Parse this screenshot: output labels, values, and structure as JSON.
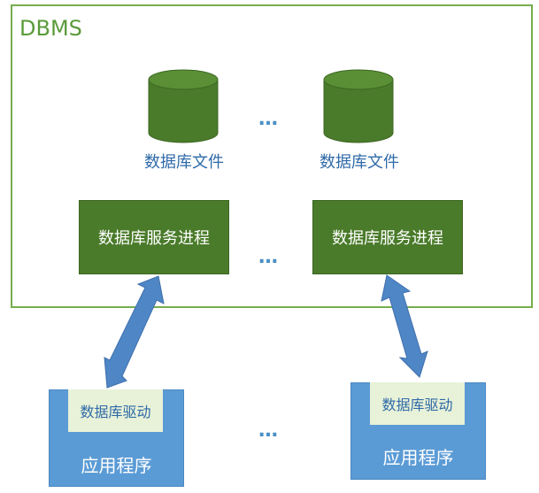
{
  "dbms": {
    "title": "DBMS",
    "files": [
      {
        "label": "数据库文件"
      },
      {
        "label": "数据库文件"
      }
    ],
    "services": [
      {
        "label": "数据库服务进程"
      },
      {
        "label": "数据库服务进程"
      }
    ]
  },
  "apps": [
    {
      "driver_label": "数据库驱动",
      "label": "应用程序"
    },
    {
      "driver_label": "数据库驱动",
      "label": "应用程序"
    }
  ],
  "ellipsis": "…",
  "colors": {
    "dbms_border": "#77ad4e",
    "cylinder": "#4a7b2a",
    "service_box": "#4a7b2a",
    "app_box": "#5b9bd5",
    "driver_box": "#e8f2d8",
    "arrow": "#4f86c6",
    "text_blue": "#2f6aa8"
  }
}
